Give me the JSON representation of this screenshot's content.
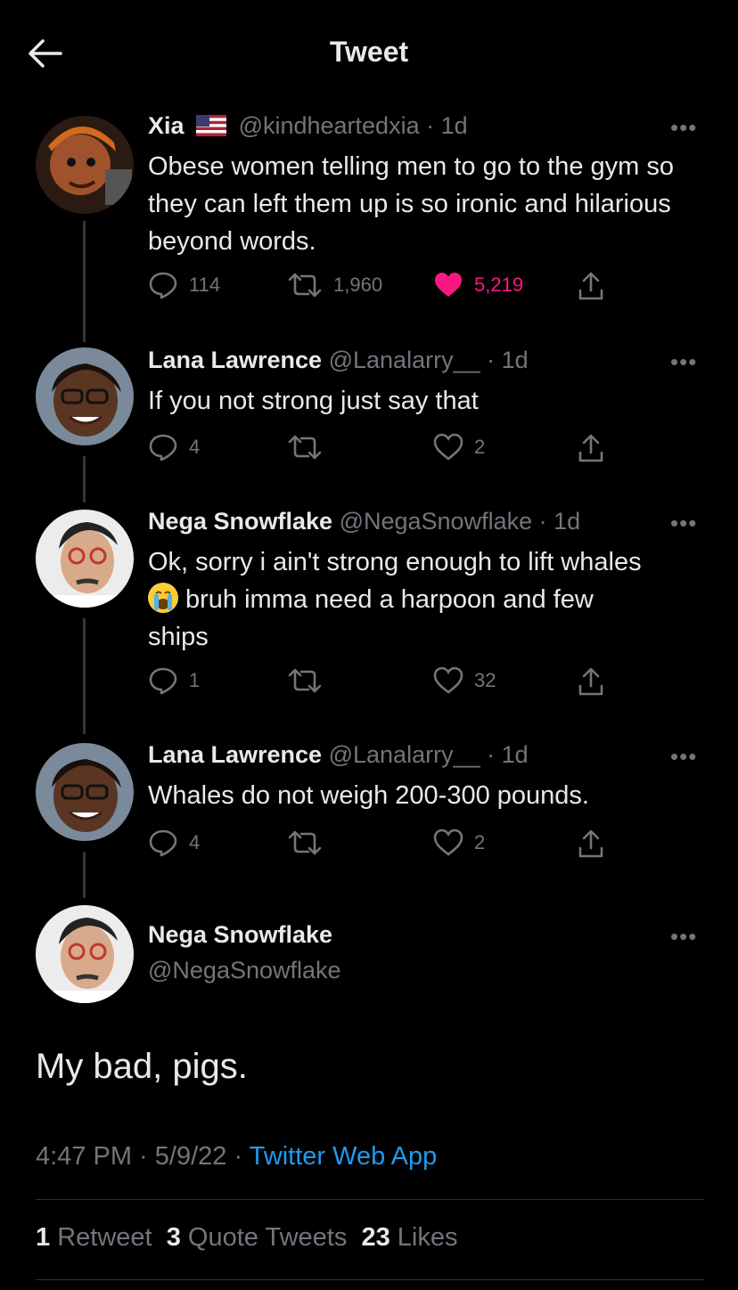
{
  "header": {
    "title": "Tweet"
  },
  "replies": [
    {
      "name": "Xia",
      "flag": "us-flag",
      "handle": "@kindheartedxia",
      "time": "· 1d",
      "text": "Obese women telling men to go to the gym so they can left them up is so ironic and hilarious beyond words.",
      "reply_count": "114",
      "retweet_count": "1,960",
      "like_count": "5,219",
      "liked": true
    },
    {
      "name": "Lana Lawrence",
      "handle": "@Lanalarry__",
      "time": "· 1d",
      "text": "If you not strong just say that",
      "reply_count": "4",
      "retweet_count": "",
      "like_count": "2"
    },
    {
      "name": "Nega Snowflake",
      "handle": "@NegaSnowflake",
      "time": "· 1d",
      "text_line1": "Ok, sorry i ain't strong enough to lift whales",
      "emoji": "crying-face-emoji",
      "text_line2": "bruh imma need a harpoon and few",
      "text_line3": "ships",
      "reply_count": "1",
      "retweet_count": "",
      "like_count": "32"
    },
    {
      "name": "Lana Lawrence",
      "handle": "@Lanalarry__",
      "time": "· 1d",
      "text": "Whales do not weigh 200-300 pounds.",
      "reply_count": "4",
      "retweet_count": "",
      "like_count": "2"
    }
  ],
  "main": {
    "name": "Nega Snowflake",
    "handle": "@NegaSnowflake",
    "text": "My bad, pigs.",
    "time": "4:47 PM · 5/9/22 · ",
    "app": "Twitter Web App",
    "stats": {
      "retweets": "1",
      "retweets_label": "Retweet",
      "quotes": "3",
      "quotes_label": "Quote Tweets",
      "likes": "23",
      "likes_label": "Likes"
    }
  },
  "colors": {
    "background": "#000000",
    "like_red": "#f91880",
    "link_blue": "#1d9bf0",
    "muted": "#71767b"
  }
}
